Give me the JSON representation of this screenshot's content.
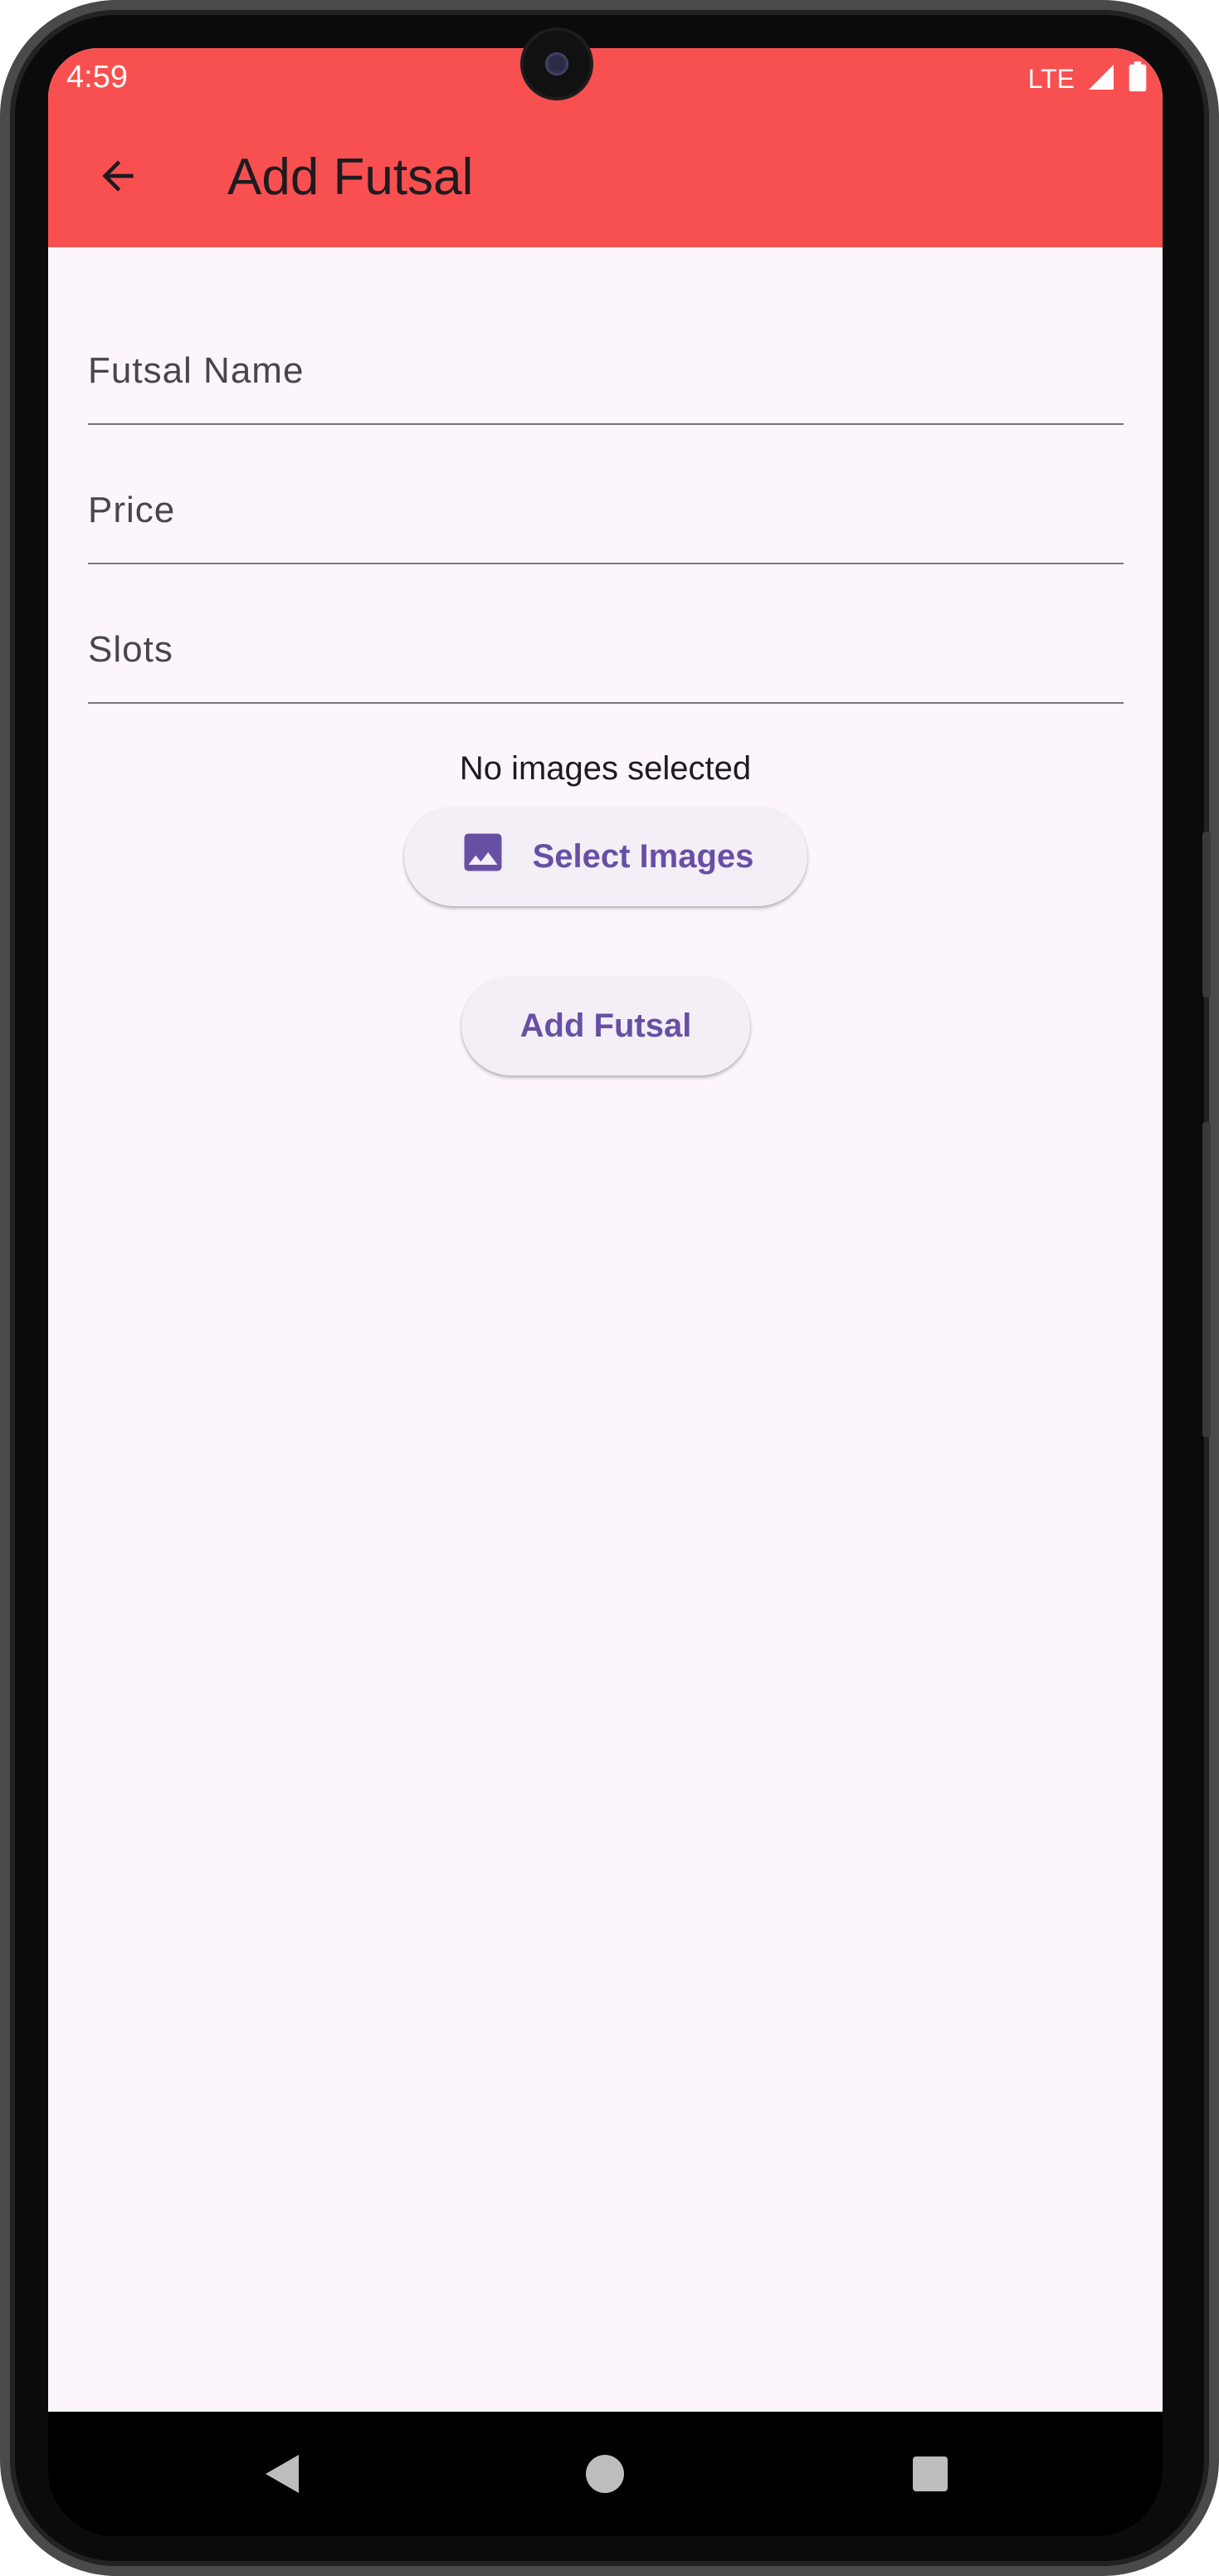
{
  "status_bar": {
    "time": "4:59",
    "network": "LTE",
    "icons": [
      "signal-icon",
      "battery-icon"
    ]
  },
  "app_bar": {
    "back_icon": "arrow-back-icon",
    "title": "Add Futsal",
    "color": "#f85050"
  },
  "form": {
    "fields": [
      {
        "label": "Futsal Name",
        "value": ""
      },
      {
        "label": "Price",
        "value": ""
      },
      {
        "label": "Slots",
        "value": ""
      }
    ],
    "images_status": "No images selected",
    "select_images_label": "Select Images",
    "select_images_icon": "image-icon",
    "submit_label": "Add Futsal"
  },
  "nav_bar": {
    "icons": [
      "back-triangle-icon",
      "home-circle-icon",
      "recents-square-icon"
    ]
  },
  "colors": {
    "accent": "#6750a4",
    "background": "#fcf6fc",
    "button_bg": "#f4eef6"
  }
}
